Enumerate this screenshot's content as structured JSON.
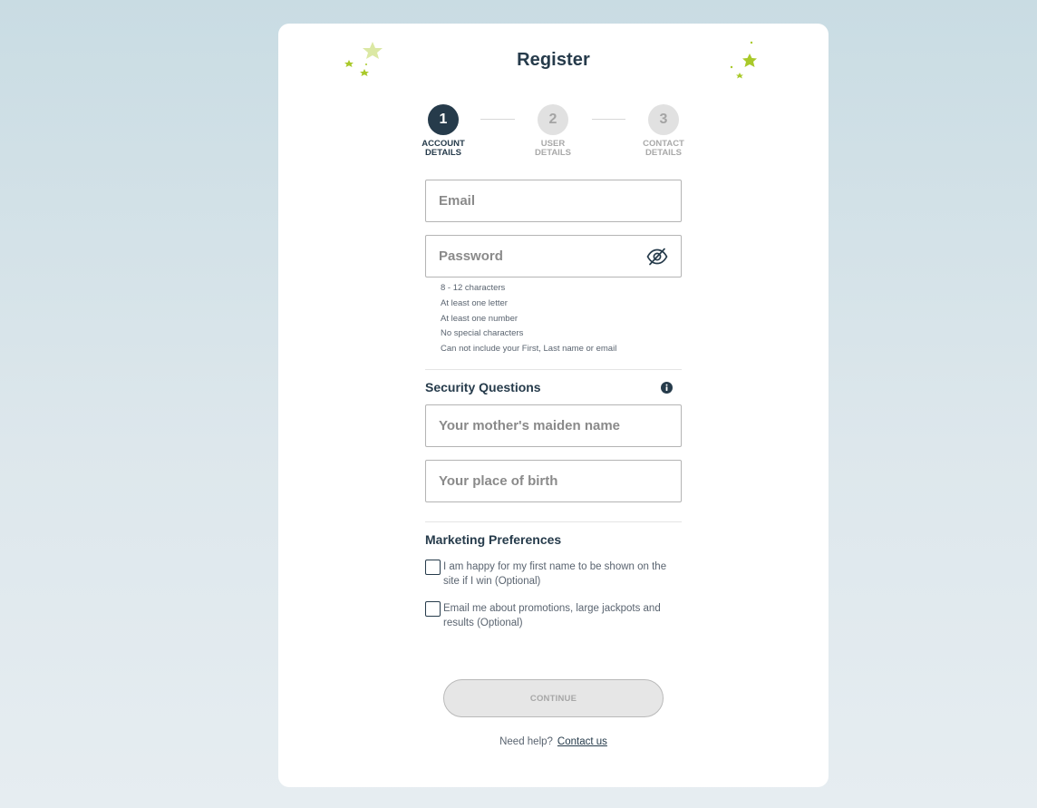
{
  "form": {
    "title": "Register",
    "steps": [
      {
        "number": "1",
        "label": "ACCOUNT\nDETAILS",
        "state": "active"
      },
      {
        "number": "2",
        "label": "USER\nDETAILS",
        "state": "inactive"
      },
      {
        "number": "3",
        "label": "CONTACT\nDETAILS",
        "state": "inactive"
      }
    ],
    "email": {
      "placeholder": "Email",
      "value": ""
    },
    "password": {
      "placeholder": "Password",
      "value": "",
      "icon": "eye-slash-icon"
    },
    "password_rules": [
      "8 - 12 characters",
      "At least one letter",
      "At least one number",
      "No special characters",
      "Can not include your First, Last name or email"
    ],
    "security": {
      "title": "Security Questions",
      "icon": "info-icon",
      "q1_placeholder": "Your mother's maiden name",
      "q2_placeholder": "Your place of birth"
    },
    "marketing": {
      "title": "Marketing Preferences",
      "options": [
        {
          "label": "I am happy for my first name to be shown on the site if I win (Optional)",
          "checked": false
        },
        {
          "label": "Email me about promotions, large jackpots and results (Optional)",
          "checked": false
        }
      ]
    },
    "continue_label": "CONTINUE",
    "help_text": "Need help?",
    "contact_link": "Contact us"
  },
  "colors": {
    "primary": "#263b4b",
    "accent_star": "#a9c92a",
    "disabled_bg": "#e6e6e6"
  }
}
